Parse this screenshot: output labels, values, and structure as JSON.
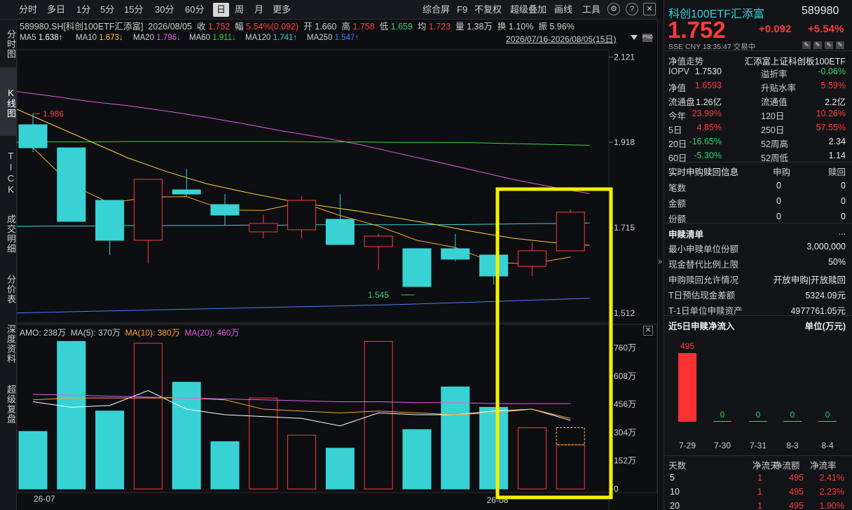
{
  "toolbar": {
    "periods": [
      "分时",
      "多日",
      "1分",
      "5分",
      "15分",
      "30分",
      "60分",
      "日",
      "周",
      "月",
      "更多"
    ],
    "selected": "日",
    "tools": [
      "综合屏",
      "F9",
      "不复权",
      "超级叠加",
      "画线",
      "工具"
    ]
  },
  "lefttabs": [
    "分时图",
    "K线图",
    "TICK",
    "成交明细",
    "分价表",
    "深度资料",
    "超级复盘"
  ],
  "header": {
    "code": "589980.SH[科创100ETF汇添富]",
    "date": "2026/08/05",
    "close_label": "收",
    "close": "1.752",
    "amp_label": "幅",
    "amp": "5.54%(0.092)",
    "open_label": "开",
    "open": "1.660",
    "high_label": "高",
    "high": "1.758",
    "low_label": "低",
    "low": "1.659",
    "avg_label": "均",
    "avg": "1.723",
    "vol_label": "量",
    "vol": "1.38万",
    "turn_label": "换",
    "turn": "1.10%",
    "swing_label": "振",
    "swing": "5.96%"
  },
  "ma_legend": [
    {
      "label": "MA5",
      "value": "1.638↑",
      "color": "#ffffff"
    },
    {
      "label": "MA10",
      "value": "1.673↓",
      "color": "#ffd23d"
    },
    {
      "label": "MA20",
      "value": "1.796↓",
      "color": "#e25de2"
    },
    {
      "label": "MA60",
      "value": "1.911↓",
      "color": "#3ad24a"
    },
    {
      "label": "MA120",
      "value": "1.741↑",
      "color": "#38d2d4"
    },
    {
      "label": "MA250",
      "value": "1.547↑",
      "color": "#4a7cff"
    }
  ],
  "range": "2026/07/16-2026/08/05(15日)",
  "price_axis": [
    "2.121",
    "1.918",
    "1.715",
    "1.512"
  ],
  "annot": {
    "high": "1.986",
    "low": "1.545"
  },
  "vol_legend": {
    "amo": "AMO: 238万",
    "ma5": "MA(5): 370万",
    "ma10": "MA(10): 380万",
    "ma20": "MA(20): 460万"
  },
  "vol_axis": [
    "760万",
    "608万",
    "456万",
    "304万",
    "152万",
    "0"
  ],
  "date_axis": [
    "26-07",
    "26-08"
  ],
  "quote": {
    "name": "科创100ETF汇添富",
    "code": "589980",
    "price": "1.752",
    "change": "+0.092",
    "pct": "+5.54%",
    "meta": "SSE  CNY  13:35:47  交易中"
  },
  "nav": {
    "title": "净值走势",
    "fund": "汇添富上证科创板100ETF"
  },
  "stats": [
    {
      "k1": "IOPV",
      "v1": "1.7530",
      "c1": "#e8e8e8",
      "k2": "溢折率",
      "v2": "-0.06%",
      "c2": "#2fd36a"
    },
    {
      "k1": "净值",
      "v1": "1.6593",
      "c1": "#ff3b3b",
      "k2": "升贴水率",
      "v2": "5.59%",
      "c2": "#ff3b3b"
    },
    {
      "k1": "流通盘",
      "v1": "1.26亿",
      "c1": "#e8e8e8",
      "k2": "流通值",
      "v2": "2.2亿",
      "c2": "#e8e8e8"
    },
    {
      "k1": "今年",
      "v1": "23.99%",
      "c1": "#ff3b3b",
      "k2": "120日",
      "v2": "10.26%",
      "c2": "#ff3b3b"
    },
    {
      "k1": "5日",
      "v1": "4.85%",
      "c1": "#ff3b3b",
      "k2": "250日",
      "v2": "57.55%",
      "c2": "#ff3b3b"
    },
    {
      "k1": "20日",
      "v1": "-16.65%",
      "c1": "#2fd36a",
      "k2": "52周高",
      "v2": "2.34",
      "c2": "#e8e8e8"
    },
    {
      "k1": "60日",
      "v1": "-5.30%",
      "c1": "#2fd36a",
      "k2": "52周低",
      "v2": "1.14",
      "c2": "#e8e8e8"
    }
  ],
  "sg": {
    "title": "实时申购赎回信息",
    "col1": "申购",
    "col2": "赎回",
    "rows": [
      {
        "k": "笔数",
        "a": "0",
        "b": "0"
      },
      {
        "k": "金额",
        "a": "0",
        "b": "0"
      },
      {
        "k": "份额",
        "a": "0",
        "b": "0"
      }
    ]
  },
  "list": {
    "title": "申赎清单",
    "more": "...",
    "rows": [
      {
        "k": "最小申赎单位份额",
        "v": "3,000,000"
      },
      {
        "k": "现金替代比例上限",
        "v": "50%"
      },
      {
        "k": "申购赎回允许情况",
        "v": "开放申购|开放赎回"
      },
      {
        "k": "T日预估现金差额",
        "v": "5324.09元"
      },
      {
        "k": "T-1日单位申赎资产",
        "v": "4977761.05元"
      }
    ]
  },
  "flow": {
    "title": "近5日申赎净流入",
    "unit": "单位(万元)",
    "bars": [
      {
        "date": "7-29",
        "value": "495"
      },
      {
        "date": "7-30",
        "value": "0"
      },
      {
        "date": "7-31",
        "value": "0"
      },
      {
        "date": "8-3",
        "value": "0"
      },
      {
        "date": "8-4",
        "value": "0"
      }
    ]
  },
  "flowtable": {
    "headers": [
      "天数",
      "净流天",
      "净流额",
      "净流率"
    ],
    "rows": [
      [
        "5",
        "1",
        "495",
        "2.41%"
      ],
      [
        "10",
        "1",
        "495",
        "2.23%"
      ],
      [
        "20",
        "1",
        "495",
        "1.90%"
      ]
    ]
  },
  "chart_data": {
    "type": "candlestick",
    "dates": [
      "07-16",
      "07-17",
      "07-20",
      "07-21",
      "07-22",
      "07-23",
      "07-24",
      "07-27",
      "07-28",
      "07-29",
      "07-30",
      "07-31",
      "08-03",
      "08-04",
      "08-05"
    ],
    "ohlc": [
      [
        1.96,
        1.986,
        1.895,
        1.905
      ],
      [
        1.905,
        1.905,
        1.73,
        1.73
      ],
      [
        1.78,
        1.78,
        1.65,
        1.685
      ],
      [
        1.685,
        1.83,
        1.63,
        1.83
      ],
      [
        1.805,
        1.855,
        1.79,
        1.795
      ],
      [
        1.77,
        1.795,
        1.72,
        1.745
      ],
      [
        1.705,
        1.745,
        1.69,
        1.725
      ],
      [
        1.71,
        1.79,
        1.69,
        1.78
      ],
      [
        1.735,
        1.795,
        1.675,
        1.675
      ],
      [
        1.695,
        1.7,
        1.615,
        1.67
      ],
      [
        1.665,
        1.665,
        1.58,
        1.575
      ],
      [
        1.665,
        1.7,
        1.635,
        1.64
      ],
      [
        1.65,
        1.65,
        1.58,
        1.6
      ],
      [
        1.623,
        1.68,
        1.6,
        1.66
      ],
      [
        1.66,
        1.758,
        1.659,
        1.752
      ]
    ],
    "volume": [
      3.1,
      7.95,
      4.2,
      7.85,
      5.75,
      2.55,
      4.9,
      2.9,
      2.2,
      7.95,
      3.2,
      5.5,
      4.4,
      3.3,
      2.38
    ],
    "up": [
      false,
      false,
      false,
      true,
      false,
      false,
      true,
      true,
      false,
      true,
      false,
      false,
      false,
      true,
      true
    ],
    "ma_volume": {
      "ma5": [
        4.7,
        4.4,
        4.5,
        5.3,
        4.3,
        4.0,
        3.9,
        3.8,
        3.4,
        4.1,
        4.0,
        4.0,
        4.2,
        4.3,
        3.7
      ],
      "ma10": [
        4.8,
        4.9,
        4.9,
        4.9,
        4.9,
        4.8,
        4.3,
        4.2,
        4.1,
        4.2,
        4.1,
        4.0,
        4.1,
        4.3,
        3.8
      ],
      "ma20": [
        5.1,
        5.05,
        5.0,
        4.95,
        4.9,
        4.85,
        4.8,
        4.75,
        4.7,
        4.7,
        4.65,
        4.65,
        4.6,
        4.6,
        4.6
      ]
    },
    "ylim": [
      1.49,
      2.13
    ],
    "vol_ylim": [
      0,
      8.0
    ]
  }
}
